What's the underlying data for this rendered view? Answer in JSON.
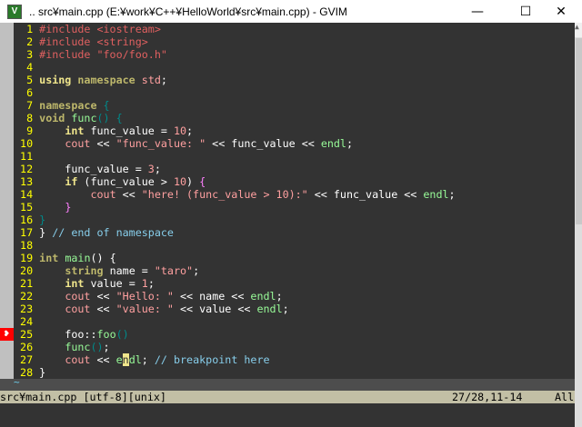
{
  "window": {
    "title": ".. src¥main.cpp  (E:¥work¥C++¥HelloWorld¥src¥main.cpp) - GVIM",
    "icon": "vim-icon",
    "minimize": "—",
    "maximize": "☐",
    "close": "✕"
  },
  "colors": {
    "background": "#333333",
    "line_number": "#ffff00",
    "status_bg": "#c2bfa5",
    "sign": "#ff0000"
  },
  "editor": {
    "breakpoint_line": 25,
    "sign_icon": "breakpoint-sign-icon",
    "cursor": {
      "line": 27,
      "col": 11
    },
    "lines": [
      {
        "n": "  1 ",
        "t": [
          [
            "#include <iostream>",
            "preproc"
          ]
        ]
      },
      {
        "n": "  2 ",
        "t": [
          [
            "#include <string>",
            "preproc"
          ]
        ]
      },
      {
        "n": "  3 ",
        "t": [
          [
            "#include \"foo/foo.h\"",
            "preproc"
          ]
        ]
      },
      {
        "n": "  4 ",
        "t": []
      },
      {
        "n": "  5 ",
        "t": [
          [
            "using",
            "kw"
          ],
          [
            " ",
            ""
          ],
          [
            "namespace",
            "type"
          ],
          [
            " ",
            ""
          ],
          [
            "std",
            "const"
          ],
          [
            ";",
            ""
          ]
        ]
      },
      {
        "n": "  6 ",
        "t": []
      },
      {
        "n": "  7 ",
        "t": [
          [
            "namespace",
            "type"
          ],
          [
            " ",
            ""
          ],
          [
            "{",
            "paren"
          ]
        ]
      },
      {
        "n": "  8 ",
        "t": [
          [
            "void",
            "type"
          ],
          [
            " ",
            ""
          ],
          [
            "func",
            "fn"
          ],
          [
            "()",
            "paren"
          ],
          [
            " ",
            ""
          ],
          [
            "{",
            "paren"
          ]
        ]
      },
      {
        "n": "  9 ",
        "t": [
          [
            "    ",
            ""
          ],
          [
            "int",
            "kw"
          ],
          [
            " func_value = ",
            ""
          ],
          [
            "10",
            "const"
          ],
          [
            ";",
            ""
          ]
        ]
      },
      {
        "n": " 10 ",
        "t": [
          [
            "    ",
            ""
          ],
          [
            "cout",
            "const"
          ],
          [
            " << ",
            ""
          ],
          [
            "\"func_value: \"",
            "const"
          ],
          [
            " << func_value << ",
            ""
          ],
          [
            "endl",
            "fn"
          ],
          [
            ";",
            ""
          ]
        ]
      },
      {
        "n": " 11 ",
        "t": []
      },
      {
        "n": " 12 ",
        "t": [
          [
            "    func_value = ",
            ""
          ],
          [
            "3",
            "const"
          ],
          [
            ";",
            ""
          ]
        ]
      },
      {
        "n": " 13 ",
        "t": [
          [
            "    ",
            ""
          ],
          [
            "if",
            "kw"
          ],
          [
            " (func_value > ",
            ""
          ],
          [
            "10",
            "const"
          ],
          [
            ") ",
            ""
          ],
          [
            "{",
            "special"
          ]
        ]
      },
      {
        "n": " 14 ",
        "t": [
          [
            "        ",
            ""
          ],
          [
            "cout",
            "const"
          ],
          [
            " << ",
            ""
          ],
          [
            "\"here! (func_value > 10):\"",
            "const"
          ],
          [
            " << func_value << ",
            ""
          ],
          [
            "endl",
            "fn"
          ],
          [
            ";",
            ""
          ]
        ]
      },
      {
        "n": " 15 ",
        "t": [
          [
            "    ",
            ""
          ],
          [
            "}",
            "special"
          ]
        ]
      },
      {
        "n": " 16 ",
        "t": [
          [
            "}",
            "paren"
          ]
        ]
      },
      {
        "n": " 17 ",
        "t": [
          [
            "} ",
            ""
          ],
          [
            "// end of namespace",
            "comment"
          ]
        ]
      },
      {
        "n": " 18 ",
        "t": []
      },
      {
        "n": " 19 ",
        "t": [
          [
            "int",
            "type"
          ],
          [
            " ",
            ""
          ],
          [
            "main",
            "fn"
          ],
          [
            "() {",
            ""
          ]
        ]
      },
      {
        "n": " 20 ",
        "t": [
          [
            "    ",
            ""
          ],
          [
            "string",
            "type"
          ],
          [
            " name = ",
            ""
          ],
          [
            "\"taro\"",
            "const"
          ],
          [
            ";",
            ""
          ]
        ]
      },
      {
        "n": " 21 ",
        "t": [
          [
            "    ",
            ""
          ],
          [
            "int",
            "kw"
          ],
          [
            " value = ",
            ""
          ],
          [
            "1",
            "const"
          ],
          [
            ";",
            ""
          ]
        ]
      },
      {
        "n": " 22 ",
        "t": [
          [
            "    ",
            ""
          ],
          [
            "cout",
            "const"
          ],
          [
            " << ",
            ""
          ],
          [
            "\"Hello: \"",
            "const"
          ],
          [
            " << name << ",
            ""
          ],
          [
            "endl",
            "fn"
          ],
          [
            ";",
            ""
          ]
        ]
      },
      {
        "n": " 23 ",
        "t": [
          [
            "    ",
            ""
          ],
          [
            "cout",
            "const"
          ],
          [
            " << ",
            ""
          ],
          [
            "\"value: \"",
            "const"
          ],
          [
            " << value << ",
            ""
          ],
          [
            "endl",
            "fn"
          ],
          [
            ";",
            ""
          ]
        ]
      },
      {
        "n": " 24 ",
        "t": []
      },
      {
        "n": " 25 ",
        "t": [
          [
            "    foo::",
            ""
          ],
          [
            "foo",
            "fn"
          ],
          [
            "()",
            "paren"
          ]
        ]
      },
      {
        "n": " 26 ",
        "t": [
          [
            "    ",
            ""
          ],
          [
            "func",
            "fn"
          ],
          [
            "()",
            "paren"
          ],
          [
            ";",
            ""
          ]
        ]
      },
      {
        "n": " 27 ",
        "t": [
          [
            "    ",
            ""
          ],
          [
            "cout",
            "const"
          ],
          [
            " << ",
            ""
          ],
          [
            "e",
            "fn"
          ],
          [
            "n",
            "cursor"
          ],
          [
            "dl",
            "fn"
          ],
          [
            "; ",
            ""
          ],
          [
            "// breakpoint here",
            "comment"
          ]
        ]
      },
      {
        "n": " 28 ",
        "t": [
          [
            "}",
            ""
          ]
        ]
      }
    ],
    "tilde": "~"
  },
  "statusline": {
    "file": "src¥main.cpp [utf-8][unix]",
    "position": "27/28,11-14",
    "scroll": "All"
  }
}
